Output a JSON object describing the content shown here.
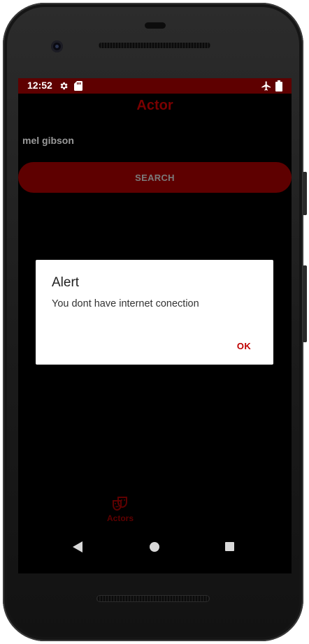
{
  "status_bar": {
    "time": "12:52",
    "icons": [
      "gear-icon",
      "sd-card-icon",
      "airplane-icon",
      "battery-icon"
    ]
  },
  "app": {
    "title": "Actor",
    "search_input_value": "mel gibson",
    "search_button_label": "SEARCH"
  },
  "bottom_nav": {
    "items": [
      {
        "label": "Actors",
        "icon": "theater-masks-icon"
      }
    ]
  },
  "dialog": {
    "title": "Alert",
    "message": "You dont have internet conection",
    "ok_label": "OK"
  },
  "colors": {
    "accent": "#5e0000",
    "title_red": "#7a0000",
    "ok_red": "#c00000",
    "background": "#000000"
  }
}
